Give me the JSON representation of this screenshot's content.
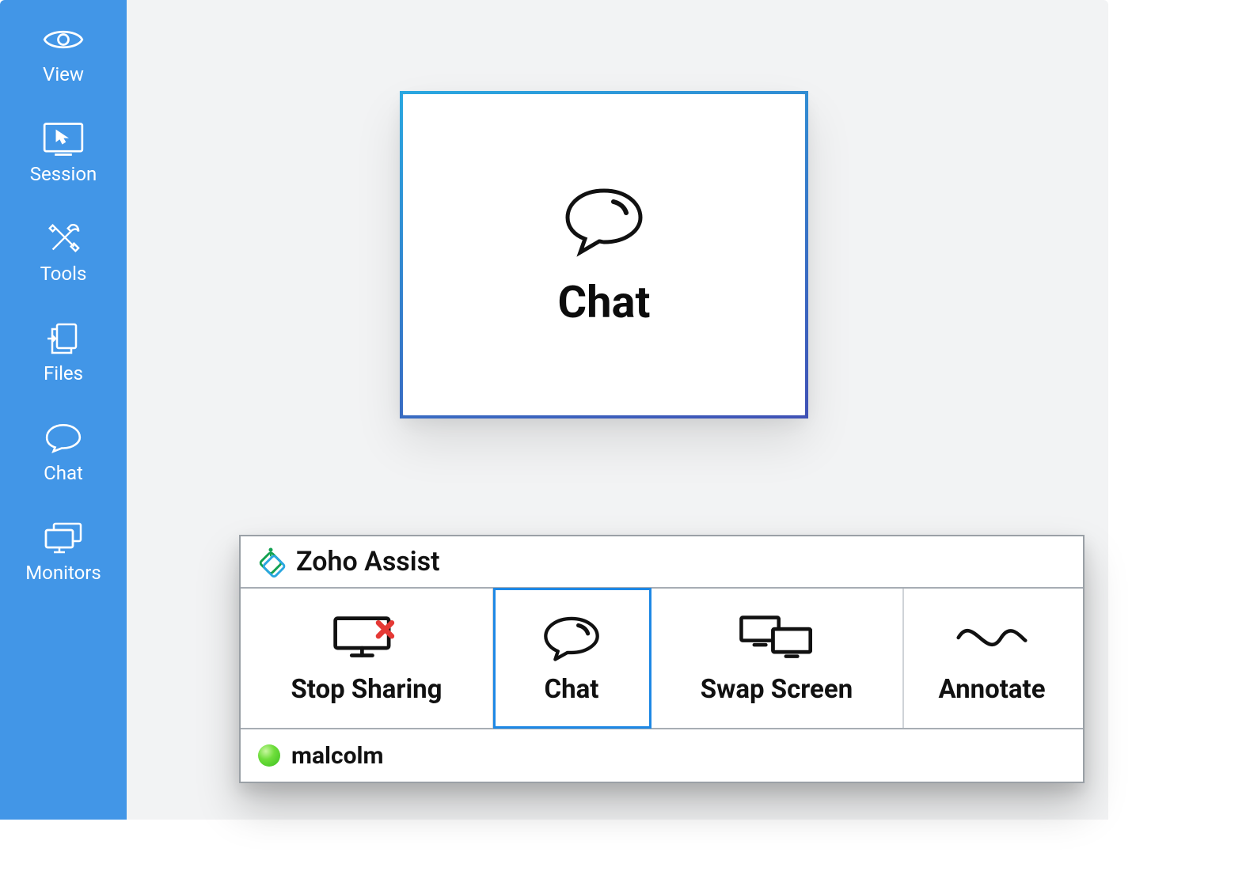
{
  "sidebar": {
    "items": [
      {
        "label": "View",
        "icon": "eye-icon"
      },
      {
        "label": "Session",
        "icon": "display-cursor-icon"
      },
      {
        "label": "Tools",
        "icon": "tools-icon"
      },
      {
        "label": "Files",
        "icon": "files-icon"
      },
      {
        "label": "Chat",
        "icon": "chat-bubble-icon"
      },
      {
        "label": "Monitors",
        "icon": "monitors-stack-icon"
      }
    ]
  },
  "highlight": {
    "label": "Chat",
    "icon": "chat-bubble-icon"
  },
  "toolbar": {
    "app_title": "Zoho Assist",
    "buttons": [
      {
        "label": "Stop Sharing",
        "icon": "stop-sharing-icon",
        "active": false
      },
      {
        "label": "Chat",
        "icon": "chat-bubble-icon",
        "active": true
      },
      {
        "label": "Swap Screen",
        "icon": "swap-screen-icon",
        "active": false
      },
      {
        "label": "Annotate",
        "icon": "annotate-wave-icon",
        "active": false
      }
    ],
    "status": {
      "user": "malcolm",
      "presence": "online",
      "presence_color": "#4cd137"
    }
  },
  "colors": {
    "sidebar_bg": "#4296e7",
    "stage_bg": "#f2f3f4",
    "highlight_border_start": "#2aa7e0",
    "highlight_border_end": "#3f51b5",
    "active_outline": "#1e88e5"
  }
}
